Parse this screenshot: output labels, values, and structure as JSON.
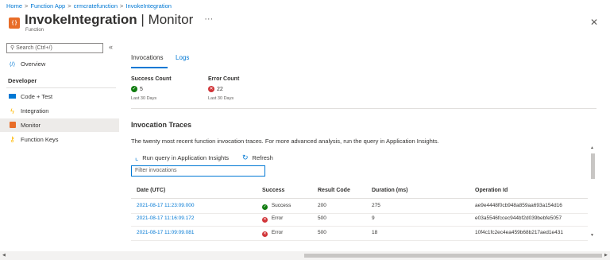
{
  "breadcrumb": [
    "Home",
    "Function App",
    "crmcratefunction",
    "InvokeIntegration"
  ],
  "title": {
    "name": "InvokeIntegration",
    "separator": " | ",
    "page": "Monitor",
    "more": "···",
    "subtitle": "Function",
    "icon": "function-icon"
  },
  "close_label": "✕",
  "sidebar": {
    "search_placeholder": "Search (Ctrl+/)",
    "collapse_label": "«",
    "overview": {
      "label": "Overview",
      "icon": "overview-icon"
    },
    "section_label": "Developer",
    "items": [
      {
        "label": "Code + Test",
        "icon": "code-icon",
        "selected": false
      },
      {
        "label": "Integration",
        "icon": "lightning-icon",
        "selected": false
      },
      {
        "label": "Monitor",
        "icon": "monitor-icon",
        "selected": true
      },
      {
        "label": "Function Keys",
        "icon": "key-icon",
        "selected": false
      }
    ]
  },
  "tabs": [
    {
      "label": "Invocations",
      "active": true
    },
    {
      "label": "Logs",
      "active": false
    }
  ],
  "metrics": {
    "success": {
      "label": "Success Count",
      "value": "5",
      "period": "Last 30 Days",
      "color": "#107c10"
    },
    "error": {
      "label": "Error Count",
      "value": "22",
      "period": "Last 30 Days",
      "color": "#d13438"
    }
  },
  "traces": {
    "title": "Invocation Traces",
    "description": "The twenty most recent function invocation traces. For more advanced analysis, run the query in Application Insights.",
    "run_query_label": "Run query in Application Insights",
    "refresh_label": "Refresh",
    "filter_placeholder": "Filter invocations",
    "columns": [
      "Date (UTC)",
      "Success",
      "Result Code",
      "Duration (ms)",
      "Operation Id"
    ],
    "rows": [
      {
        "date": "2021-08-17 11:23:09.000",
        "success": "Success",
        "ok": true,
        "code": "200",
        "duration": "275",
        "op": "ae9e4448f0cb948a859aa693a154d16"
      },
      {
        "date": "2021-08-17 11:16:09.172",
        "success": "Error",
        "ok": false,
        "code": "500",
        "duration": "9",
        "op": "e03a5546fccec944bf2d039bebfe5057"
      },
      {
        "date": "2021-08-17 11:09:09.081",
        "success": "Error",
        "ok": false,
        "code": "500",
        "duration": "18",
        "op": "10f4c1fc2ec4ea459b68b217aed1e431"
      }
    ]
  }
}
